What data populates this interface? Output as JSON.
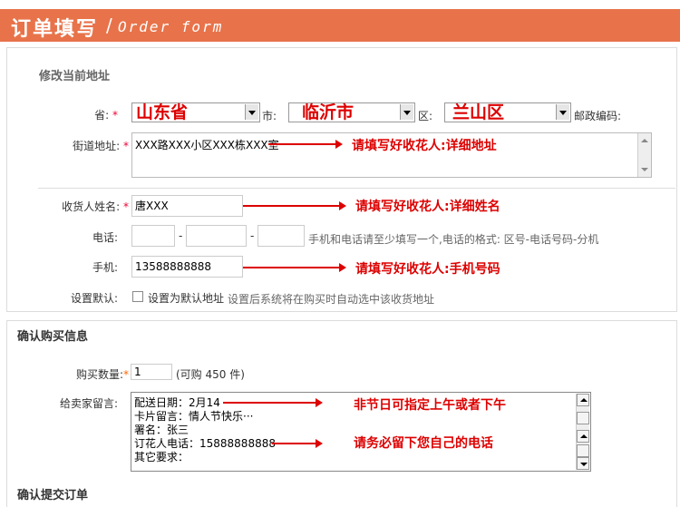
{
  "header": {
    "title": "订单填写",
    "slash": "/",
    "subtitle": "Order form"
  },
  "address": {
    "section_title": "修改当前地址",
    "province_label": "省:",
    "province_value": "山东省",
    "city_label": "市:",
    "city_value": "临沂市",
    "district_label": "区:",
    "district_value": "兰山区",
    "postcode_label": "邮政编码:",
    "street_label": "街道地址:",
    "street_value": "XXX路XXX小区XXX栋XXX室",
    "street_annotation": "请填写好收花人:详细地址",
    "required_mark": "*",
    "name_label": "收货人姓名:",
    "name_value": "唐XXX",
    "name_annotation": "请填写好收花人:详细姓名",
    "phone_label": "电话:",
    "phone_dash": "-",
    "phone_note": "手机和电话请至少填写一个,电话的格式: 区号-电话号码-分机",
    "mobile_label": "手机:",
    "mobile_value": "13588888888",
    "mobile_annotation": "请填写好收花人:手机号码",
    "default_label": "设置默认:",
    "default_checkbox_label": "设置为默认地址",
    "default_note": "设置后系统将在购买时自动选中该收货地址"
  },
  "purchase": {
    "section_title": "确认购买信息",
    "qty_label": "购买数量:",
    "qty_value": "1",
    "qty_available": "(可购 450 件)",
    "message_label": "给卖家留言:",
    "message_lines": [
      "配送日期：2月14",
      "卡片留言：情人节快乐···",
      "署名：张三",
      "订花人电话：15888888888",
      "其它要求："
    ],
    "annotation_1": "非节日可指定上午或者下午",
    "annotation_2": "请务必留下您自己的电话"
  },
  "submit": {
    "section_title": "确认提交订单"
  },
  "colors": {
    "header": "#e8734a",
    "annotation": "#dd0000",
    "required": "#ee0033"
  }
}
